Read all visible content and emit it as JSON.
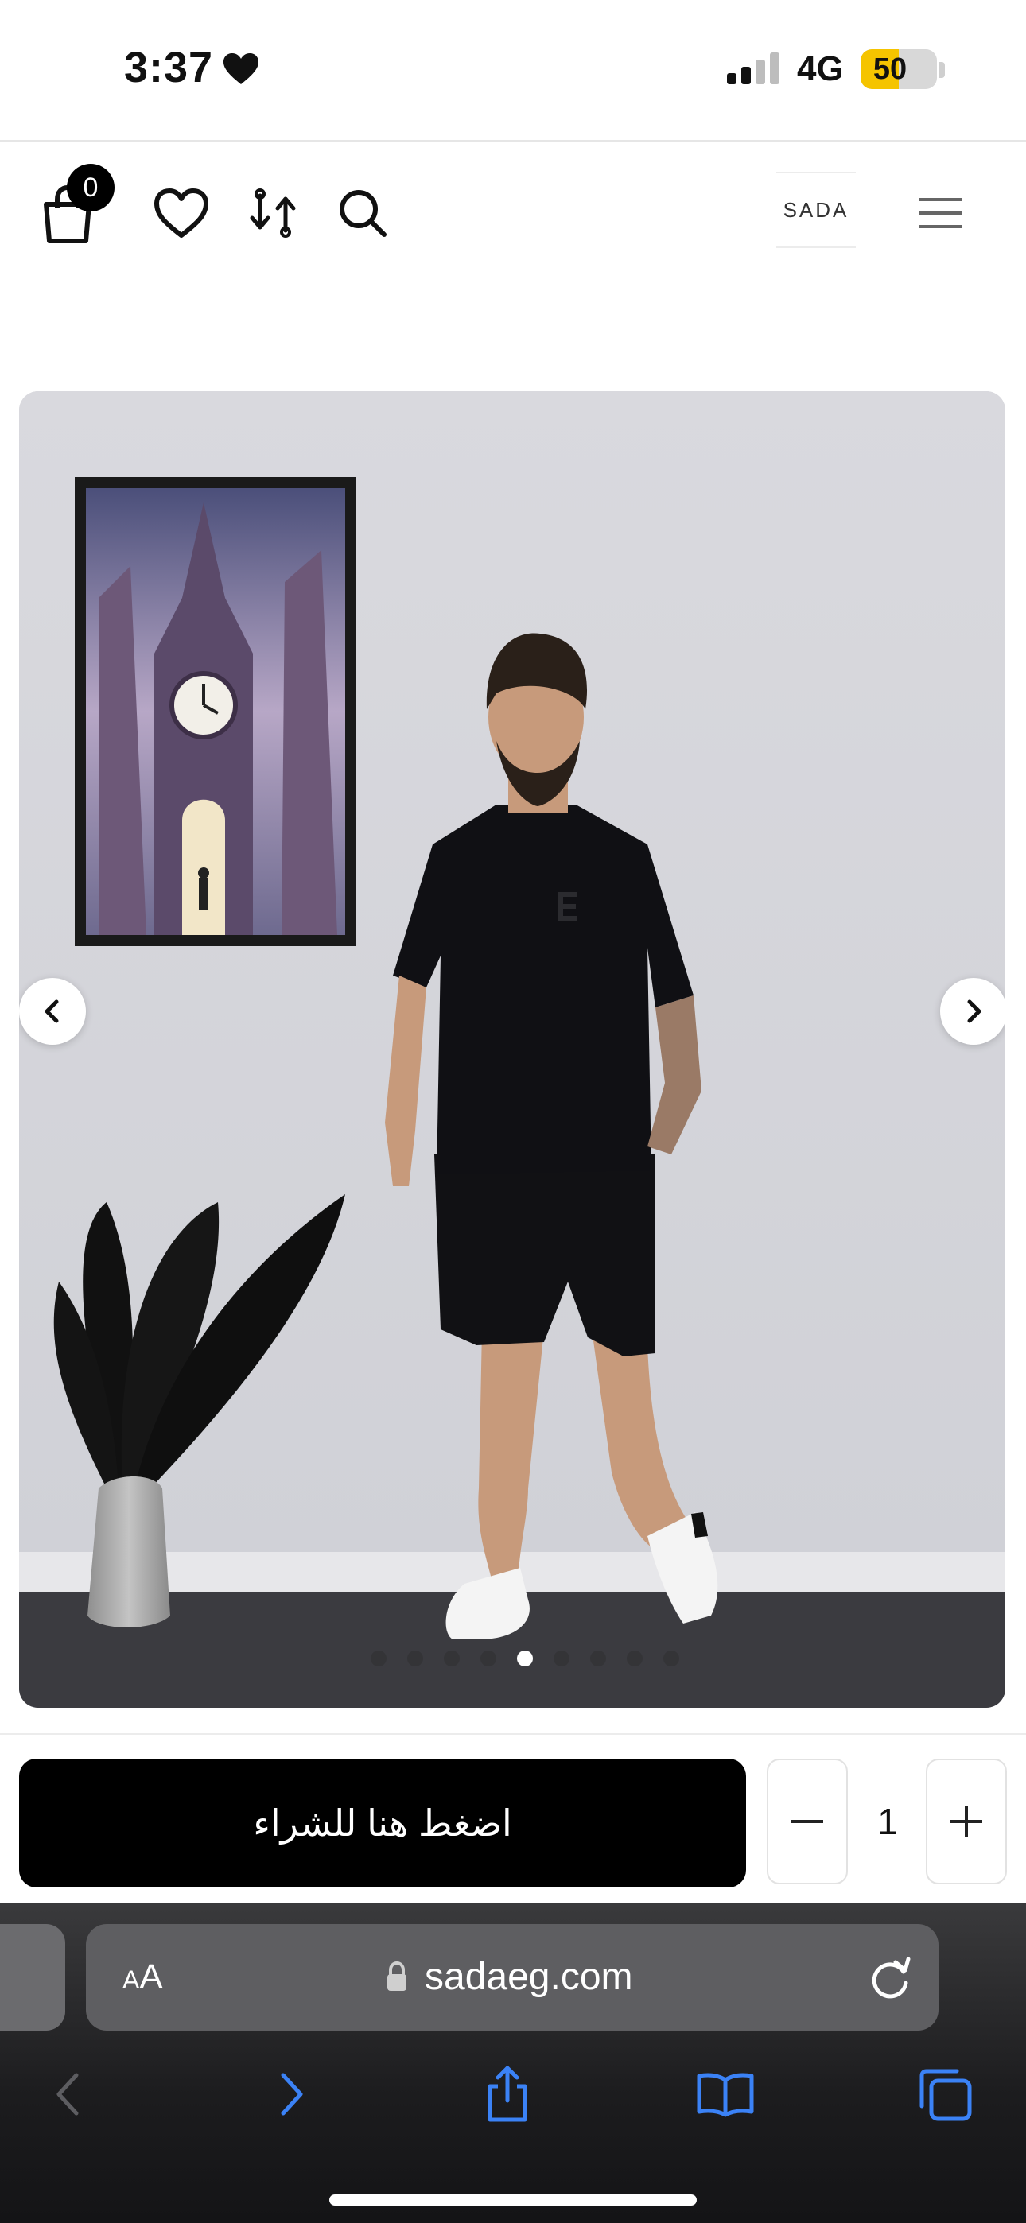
{
  "status_bar": {
    "time": "3:37",
    "heart_icon": "heart-icon",
    "network": "4G",
    "battery_level": "50",
    "battery_fraction": 0.5
  },
  "header": {
    "cart_count": "0",
    "logo_text": "SADA",
    "icons": [
      "shopping-bag-icon",
      "heart-icon",
      "compare-icon",
      "search-icon",
      "hamburger-menu-icon"
    ]
  },
  "carousel": {
    "image_description": "product-photo",
    "active_index": 4,
    "total_slides": 9,
    "prev_icon": "chevron-left-icon",
    "next_icon": "chevron-right-icon"
  },
  "purchase": {
    "buy_label": "اضغط هنا للشراء",
    "quantity": "1",
    "minus_icon": "minus-icon",
    "plus_icon": "plus-icon"
  },
  "browser": {
    "text_size_small": "A",
    "text_size_large": "A",
    "url": "sadaeg.com",
    "toolbar_icons": [
      "back-icon",
      "forward-icon",
      "share-icon",
      "bookmarks-icon",
      "tabs-icon"
    ]
  },
  "colors": {
    "accent_black": "#000000",
    "safari_blue": "#3b82f6",
    "battery_yellow": "#f5c400"
  }
}
